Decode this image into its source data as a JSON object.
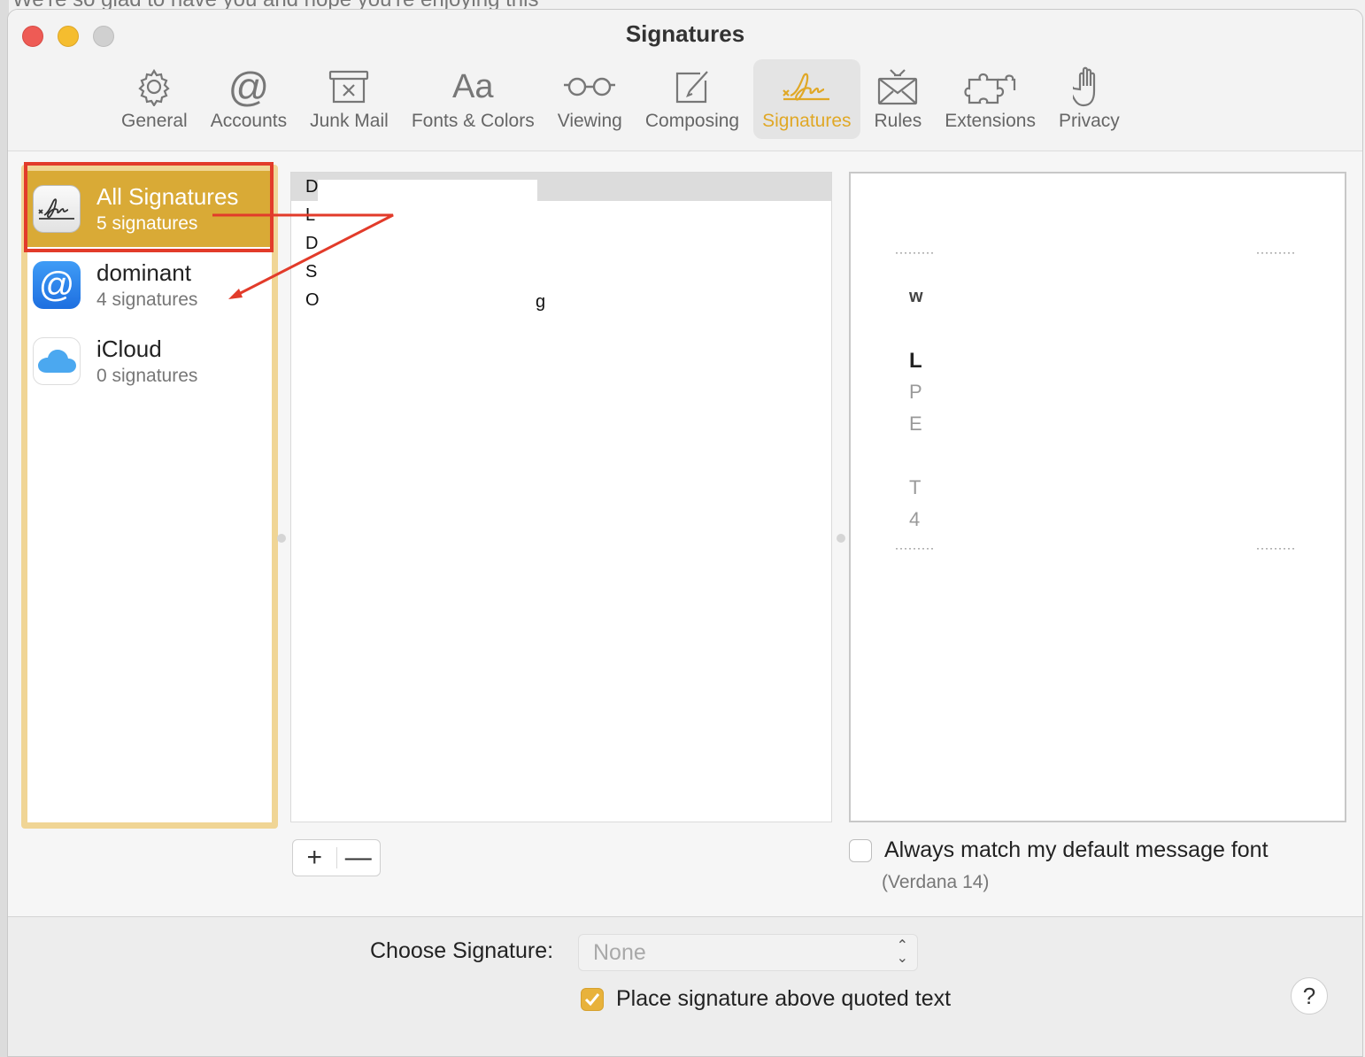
{
  "background": {
    "top_text": "We're so glad to have you and hope you're enjoying this"
  },
  "window": {
    "title": "Signatures"
  },
  "toolbar": {
    "items": [
      {
        "label": "General",
        "icon": "gear-icon"
      },
      {
        "label": "Accounts",
        "icon": "at-sign-icon"
      },
      {
        "label": "Junk Mail",
        "icon": "junk-bin-icon"
      },
      {
        "label": "Fonts & Colors",
        "icon": "font-aa-icon"
      },
      {
        "label": "Viewing",
        "icon": "glasses-icon"
      },
      {
        "label": "Composing",
        "icon": "compose-icon"
      },
      {
        "label": "Signatures",
        "icon": "signature-icon",
        "active": true
      },
      {
        "label": "Rules",
        "icon": "rules-envelope-icon"
      },
      {
        "label": "Extensions",
        "icon": "puzzle-icon"
      },
      {
        "label": "Privacy",
        "icon": "hand-icon"
      }
    ]
  },
  "accounts": [
    {
      "name": "All Signatures",
      "count": "5 signatures",
      "icon": "signature-icon",
      "selected": true
    },
    {
      "name": "dominant",
      "count": "4 signatures",
      "icon": "at-sign-icon"
    },
    {
      "name": "iCloud",
      "count": "0 signatures",
      "icon": "icloud-icon"
    }
  ],
  "signatures": [
    "D",
    "L",
    "D",
    "S",
    "O"
  ],
  "signature_trailing_char": "g",
  "preview": {
    "chars": [
      "w",
      "L",
      "P",
      "E",
      "T",
      "4"
    ]
  },
  "buttons": {
    "add": "+",
    "remove": "—",
    "help": "?"
  },
  "match_font": {
    "label": "Always match my default message font",
    "sub": "(Verdana 14)",
    "checked": false
  },
  "choose_signature": {
    "label": "Choose Signature:",
    "value": "None"
  },
  "place_above": {
    "label": "Place signature above quoted text",
    "checked": true
  },
  "colors": {
    "accent": "#e0a826",
    "selection": "#d9aa36",
    "annotation": "#e23b2a"
  }
}
